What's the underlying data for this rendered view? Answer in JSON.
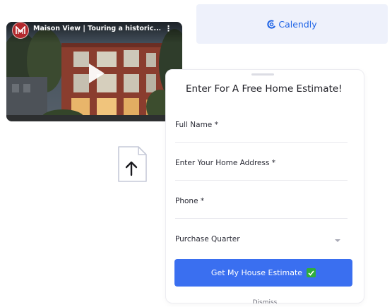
{
  "calendly": {
    "label": "Calendly"
  },
  "video": {
    "title": "Maison View | Touring a historic...",
    "channel_icon": "maison-view-logo",
    "menu_icon": "kebab-menu-icon",
    "play_icon": "play-icon"
  },
  "upload": {
    "icon": "file-upload-icon"
  },
  "form": {
    "title": "Enter For A Free Home Estimate!",
    "fields": [
      {
        "label": "Full Name *"
      },
      {
        "label": "Enter Your Home Address *"
      },
      {
        "label": "Phone *"
      },
      {
        "label": "Purchase Quarter",
        "type": "select"
      }
    ],
    "submit_label": "Get My House Estimate",
    "submit_icon": "check-emoji-icon",
    "dismiss_label": "Dismiss"
  },
  "colors": {
    "accent": "#3a6ff0",
    "calendly_blue": "#1f64e6",
    "check_green": "#2fae3c"
  }
}
